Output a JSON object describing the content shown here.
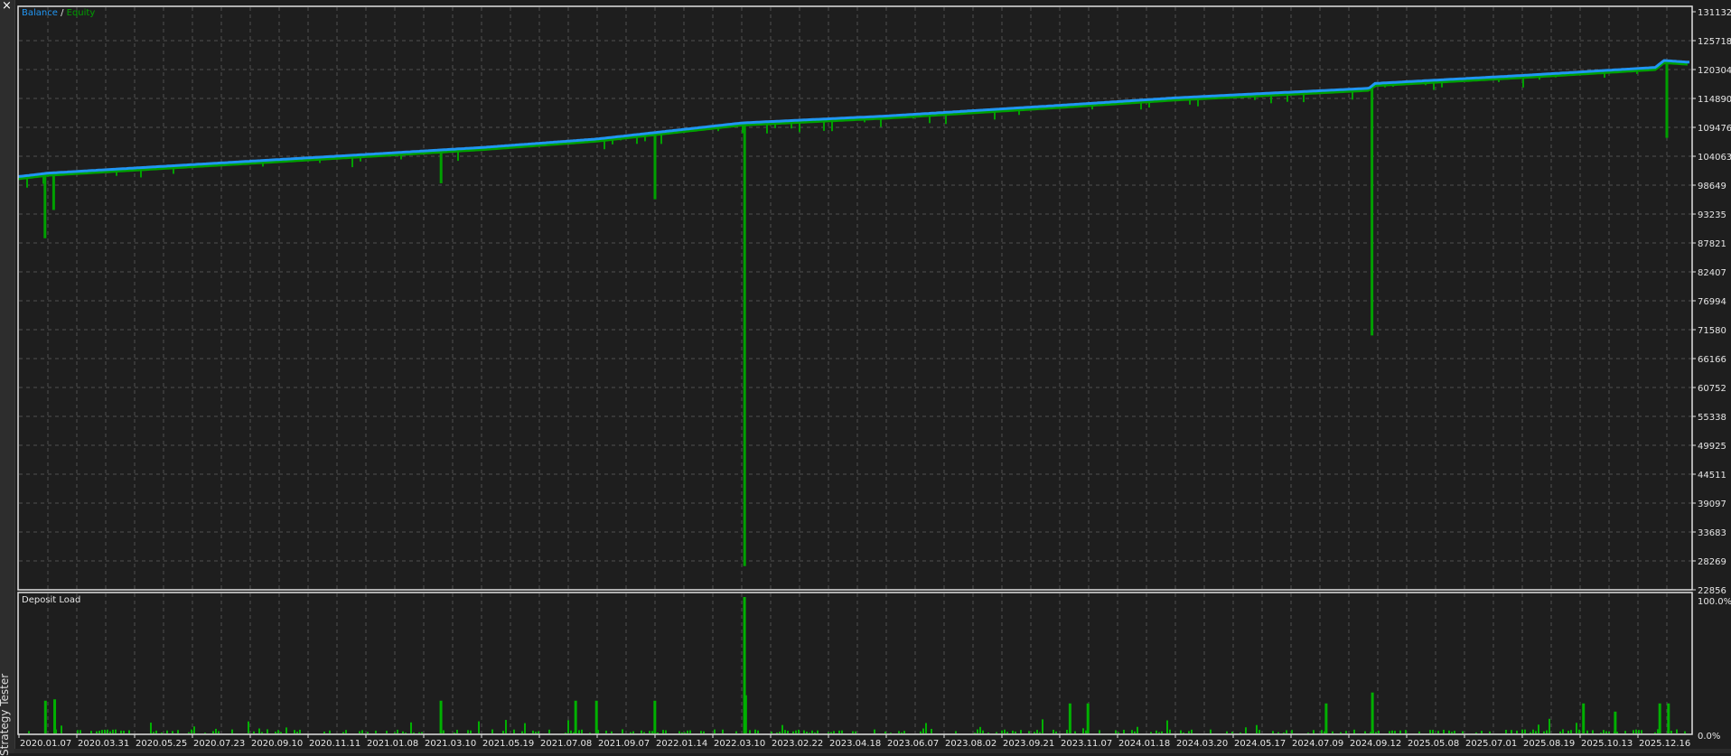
{
  "panel": {
    "close_icon": "close-icon",
    "side_label": "Strategy Tester"
  },
  "colors": {
    "background": "#1e1e1e",
    "grid": "#505050",
    "border": "#e0e0e0",
    "balance": "#2196f3",
    "equity": "#00a000",
    "load": "#00b000"
  },
  "chart_data": [
    {
      "type": "line",
      "title": "Balance / Equity",
      "legend": {
        "balance": "Balance",
        "separator": " / ",
        "equity": "Equity",
        "placement": "top-left"
      },
      "x_note": "x values expressed as position index of the date tick labels",
      "x_tick_labels": [
        "2020.01.07",
        "2020.03.31",
        "2020.05.25",
        "2020.07.23",
        "2020.09.10",
        "2020.11.11",
        "2021.01.08",
        "2021.03.10",
        "2021.05.19",
        "2021.07.08",
        "2021.09.07",
        "2022.01.14",
        "2022.03.10",
        "2023.02.22",
        "2023.04.18",
        "2023.06.07",
        "2023.08.02",
        "2023.09.21",
        "2023.11.07",
        "2024.01.18",
        "2024.03.20",
        "2024.05.17",
        "2024.07.09",
        "2024.09.12",
        "2025.05.08",
        "2025.07.01",
        "2025.08.19",
        "2025.10.13",
        "2025.12.16"
      ],
      "y_tick_labels": [
        "131132",
        "125718",
        "120304",
        "114890",
        "109476",
        "104063",
        "98649",
        "93235",
        "87821",
        "82407",
        "76994",
        "71580",
        "66166",
        "60752",
        "55338",
        "49925",
        "44511",
        "39097",
        "33683",
        "28269",
        "22856"
      ],
      "ylim": [
        22856,
        131132
      ],
      "grid": true,
      "balance": [
        [
          -0.05,
          100200
        ],
        [
          0.5,
          100900
        ],
        [
          3,
          102500
        ],
        [
          6,
          104400
        ],
        [
          8,
          105700
        ],
        [
          10,
          107300
        ],
        [
          12.5,
          110300
        ],
        [
          15,
          111600
        ],
        [
          18,
          113600
        ],
        [
          20,
          115000
        ],
        [
          23.35,
          116800
        ],
        [
          23.45,
          117700
        ],
        [
          26,
          119200
        ],
        [
          28.3,
          120700
        ],
        [
          28.45,
          122000
        ],
        [
          28.85,
          121700
        ]
      ],
      "equity_drawdowns": [
        {
          "x": 0.45,
          "min": 88700
        },
        {
          "x": 0.6,
          "min": 94000
        },
        {
          "x": 7.3,
          "min": 99000
        },
        {
          "x": 11.0,
          "min": 96000
        },
        {
          "x": 12.55,
          "min": 27300
        },
        {
          "x": 23.4,
          "min": 70500
        },
        {
          "x": 28.5,
          "min": 107500
        }
      ]
    },
    {
      "type": "bar",
      "title": "Deposit Load",
      "y_tick_labels": [
        "100.0%",
        "0.0%"
      ],
      "ylim": [
        0,
        100
      ],
      "spikes": [
        {
          "x": 0.45,
          "pct": 24
        },
        {
          "x": 0.61,
          "pct": 25
        },
        {
          "x": 7.29,
          "pct": 24
        },
        {
          "x": 9.62,
          "pct": 24
        },
        {
          "x": 9.98,
          "pct": 24
        },
        {
          "x": 10.99,
          "pct": 24
        },
        {
          "x": 12.54,
          "pct": 100
        },
        {
          "x": 12.56,
          "pct": 28
        },
        {
          "x": 18.17,
          "pct": 22
        },
        {
          "x": 18.48,
          "pct": 22
        },
        {
          "x": 22.6,
          "pct": 22
        },
        {
          "x": 23.4,
          "pct": 30
        },
        {
          "x": 27.05,
          "pct": 22
        },
        {
          "x": 27.6,
          "pct": 16
        },
        {
          "x": 28.37,
          "pct": 22
        },
        {
          "x": 28.52,
          "pct": 22
        }
      ]
    }
  ]
}
